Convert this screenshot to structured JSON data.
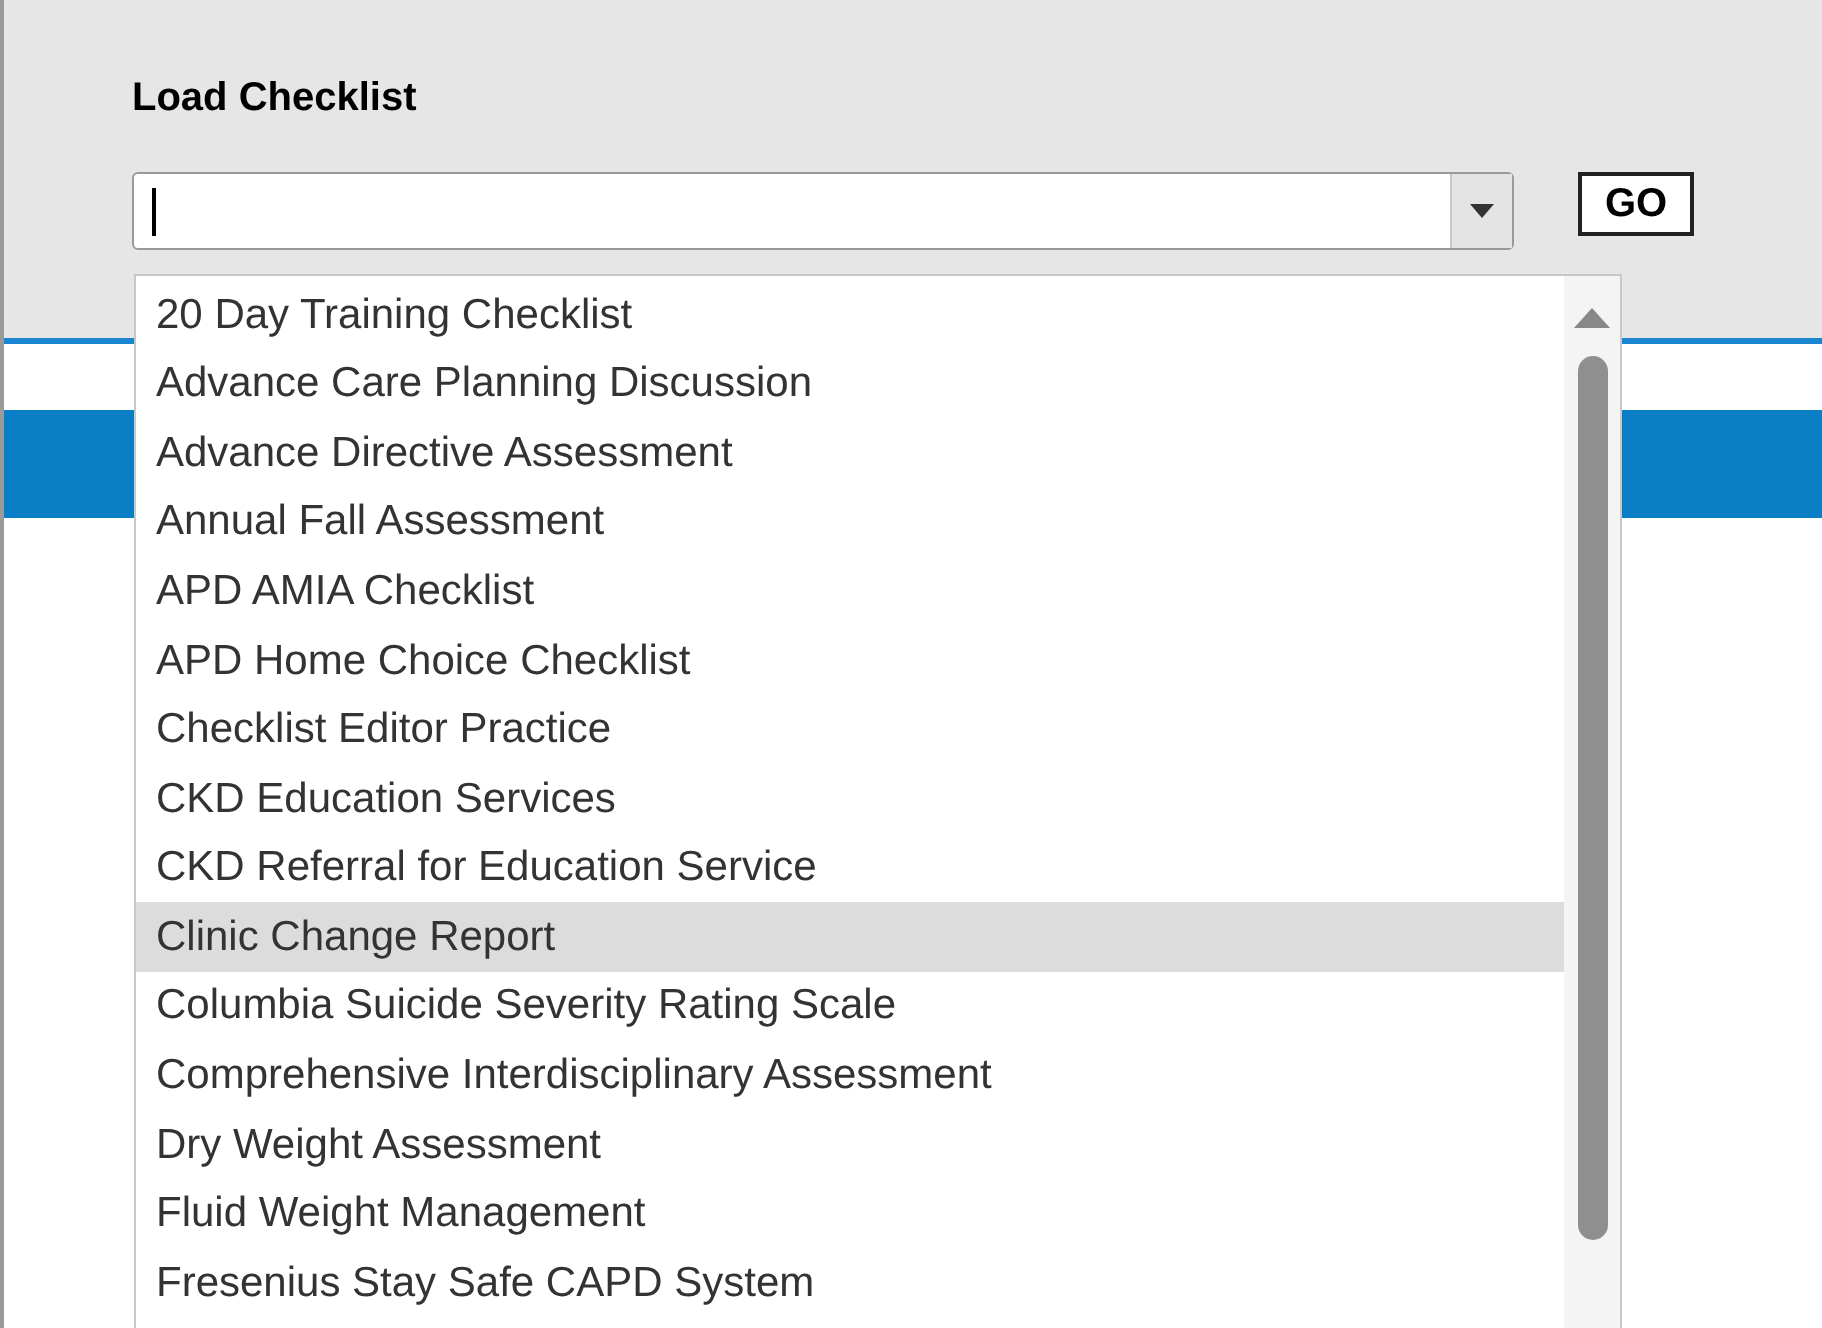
{
  "header": {
    "title": "Load Checklist"
  },
  "combo": {
    "expanded": true
  },
  "go_button": {
    "label": "GO"
  },
  "options": [
    {
      "label": "20 Day Training Checklist",
      "selected": false
    },
    {
      "label": "Advance Care Planning Discussion",
      "selected": false
    },
    {
      "label": "Advance Directive Assessment",
      "selected": false
    },
    {
      "label": "Annual Fall Assessment",
      "selected": false
    },
    {
      "label": "APD AMIA Checklist",
      "selected": false
    },
    {
      "label": "APD Home Choice Checklist",
      "selected": false
    },
    {
      "label": "Checklist Editor Practice",
      "selected": false
    },
    {
      "label": "CKD Education Services",
      "selected": false
    },
    {
      "label": "CKD Referral for Education Service",
      "selected": false
    },
    {
      "label": "Clinic Change Report",
      "selected": true
    },
    {
      "label": "Columbia Suicide Severity Rating Scale",
      "selected": false
    },
    {
      "label": "Comprehensive Interdisciplinary Assessment",
      "selected": false
    },
    {
      "label": "Dry Weight Assessment",
      "selected": false
    },
    {
      "label": "Fluid Weight Management",
      "selected": false
    },
    {
      "label": "Fresenius Stay Safe CAPD System",
      "selected": false
    }
  ]
}
